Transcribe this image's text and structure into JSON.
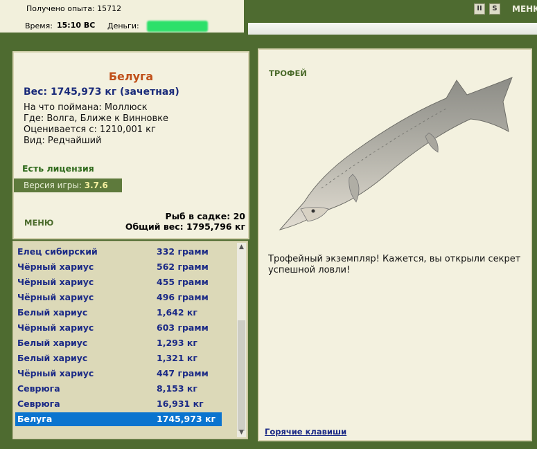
{
  "status": {
    "exp_label": "Получено опыта: 15712",
    "time_label": "Время:",
    "time_value": "15:10 ВС",
    "money_label": "Деньги:"
  },
  "topbar": {
    "menu_label": "МЕНЮ",
    "icons": [
      "pause-icon",
      "settings-icon"
    ],
    "pause_glyph": "II",
    "settings_glyph": "S"
  },
  "catch": {
    "title": "Белуга",
    "weight": "Вес: 1745,973 кг (зачетная)",
    "bait": "На что поймана: Моллюск",
    "place": "Где: Волга, Ближе к Винновке",
    "value": "Оценивается с: 1210,001 кг",
    "kind": "Вид: Редчайший",
    "license": "Есть лицензия",
    "version_label": "Версия игры:",
    "version_value": "3.7.6",
    "menu_label": "МЕНЮ",
    "cage_count": "Рыб в садке: 20",
    "cage_weight": "Общий вес: 1795,796 кг"
  },
  "fish_list": [
    {
      "name": "Елец сибирский",
      "weight": "332 грамм"
    },
    {
      "name": "Чёрный хариус",
      "weight": "562 грамм"
    },
    {
      "name": "Чёрный хариус",
      "weight": "455 грамм"
    },
    {
      "name": "Чёрный хариус",
      "weight": "496 грамм"
    },
    {
      "name": "Белый хариус",
      "weight": "1,642 кг"
    },
    {
      "name": "Чёрный хариус",
      "weight": "603 грамм"
    },
    {
      "name": "Белый хариус",
      "weight": "1,293 кг"
    },
    {
      "name": "Белый хариус",
      "weight": "1,321 кг"
    },
    {
      "name": "Чёрный хариус",
      "weight": "447 грамм"
    },
    {
      "name": "Севрюга",
      "weight": "8,153 кг"
    },
    {
      "name": "Севрюга",
      "weight": "16,931 кг"
    },
    {
      "name": "Белуга",
      "weight": "1745,973 кг",
      "selected": true
    }
  ],
  "trophy": {
    "label": "ТРОФЕЙ",
    "description": "Трофейный экземпляр! Кажется, вы открыли секрет успешной ловли!",
    "hotkeys": "Горячие клавиши"
  },
  "colors": {
    "background": "#4e6b30",
    "panel": "#f3f1df",
    "selection": "#0a74cf",
    "title": "#c0501a",
    "list_text": "#1b2a86"
  }
}
